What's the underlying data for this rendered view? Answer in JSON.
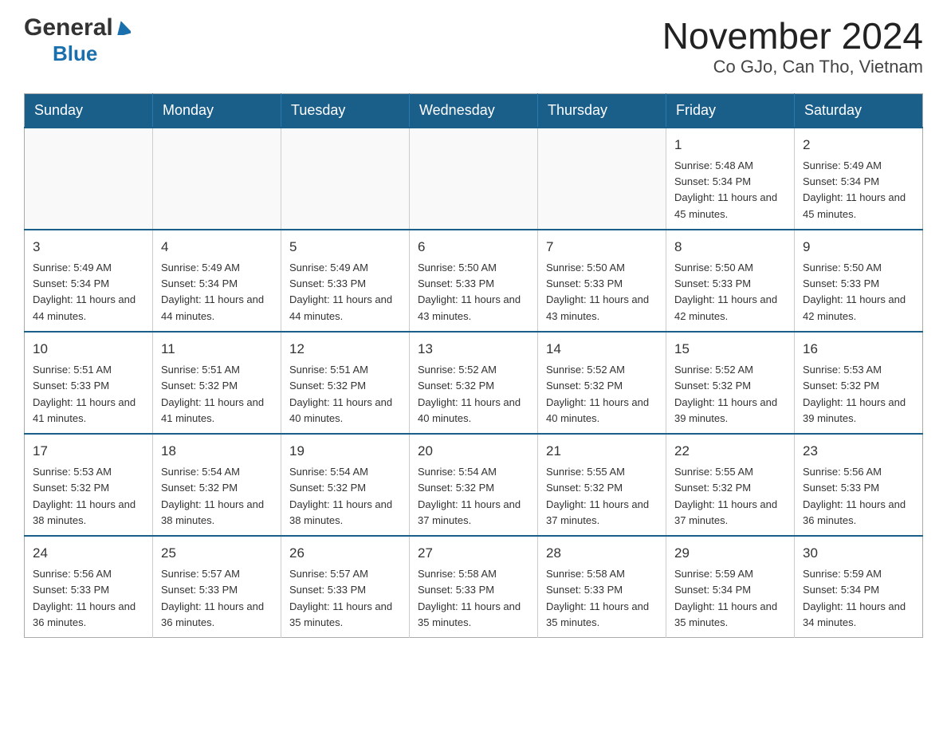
{
  "header": {
    "logo_general": "General",
    "logo_blue": "Blue",
    "title": "November 2024",
    "subtitle": "Co GJo, Can Tho, Vietnam"
  },
  "calendar": {
    "days_of_week": [
      "Sunday",
      "Monday",
      "Tuesday",
      "Wednesday",
      "Thursday",
      "Friday",
      "Saturday"
    ],
    "weeks": [
      [
        {
          "day": "",
          "info": ""
        },
        {
          "day": "",
          "info": ""
        },
        {
          "day": "",
          "info": ""
        },
        {
          "day": "",
          "info": ""
        },
        {
          "day": "",
          "info": ""
        },
        {
          "day": "1",
          "info": "Sunrise: 5:48 AM\nSunset: 5:34 PM\nDaylight: 11 hours and 45 minutes."
        },
        {
          "day": "2",
          "info": "Sunrise: 5:49 AM\nSunset: 5:34 PM\nDaylight: 11 hours and 45 minutes."
        }
      ],
      [
        {
          "day": "3",
          "info": "Sunrise: 5:49 AM\nSunset: 5:34 PM\nDaylight: 11 hours and 44 minutes."
        },
        {
          "day": "4",
          "info": "Sunrise: 5:49 AM\nSunset: 5:34 PM\nDaylight: 11 hours and 44 minutes."
        },
        {
          "day": "5",
          "info": "Sunrise: 5:49 AM\nSunset: 5:33 PM\nDaylight: 11 hours and 44 minutes."
        },
        {
          "day": "6",
          "info": "Sunrise: 5:50 AM\nSunset: 5:33 PM\nDaylight: 11 hours and 43 minutes."
        },
        {
          "day": "7",
          "info": "Sunrise: 5:50 AM\nSunset: 5:33 PM\nDaylight: 11 hours and 43 minutes."
        },
        {
          "day": "8",
          "info": "Sunrise: 5:50 AM\nSunset: 5:33 PM\nDaylight: 11 hours and 42 minutes."
        },
        {
          "day": "9",
          "info": "Sunrise: 5:50 AM\nSunset: 5:33 PM\nDaylight: 11 hours and 42 minutes."
        }
      ],
      [
        {
          "day": "10",
          "info": "Sunrise: 5:51 AM\nSunset: 5:33 PM\nDaylight: 11 hours and 41 minutes."
        },
        {
          "day": "11",
          "info": "Sunrise: 5:51 AM\nSunset: 5:32 PM\nDaylight: 11 hours and 41 minutes."
        },
        {
          "day": "12",
          "info": "Sunrise: 5:51 AM\nSunset: 5:32 PM\nDaylight: 11 hours and 40 minutes."
        },
        {
          "day": "13",
          "info": "Sunrise: 5:52 AM\nSunset: 5:32 PM\nDaylight: 11 hours and 40 minutes."
        },
        {
          "day": "14",
          "info": "Sunrise: 5:52 AM\nSunset: 5:32 PM\nDaylight: 11 hours and 40 minutes."
        },
        {
          "day": "15",
          "info": "Sunrise: 5:52 AM\nSunset: 5:32 PM\nDaylight: 11 hours and 39 minutes."
        },
        {
          "day": "16",
          "info": "Sunrise: 5:53 AM\nSunset: 5:32 PM\nDaylight: 11 hours and 39 minutes."
        }
      ],
      [
        {
          "day": "17",
          "info": "Sunrise: 5:53 AM\nSunset: 5:32 PM\nDaylight: 11 hours and 38 minutes."
        },
        {
          "day": "18",
          "info": "Sunrise: 5:54 AM\nSunset: 5:32 PM\nDaylight: 11 hours and 38 minutes."
        },
        {
          "day": "19",
          "info": "Sunrise: 5:54 AM\nSunset: 5:32 PM\nDaylight: 11 hours and 38 minutes."
        },
        {
          "day": "20",
          "info": "Sunrise: 5:54 AM\nSunset: 5:32 PM\nDaylight: 11 hours and 37 minutes."
        },
        {
          "day": "21",
          "info": "Sunrise: 5:55 AM\nSunset: 5:32 PM\nDaylight: 11 hours and 37 minutes."
        },
        {
          "day": "22",
          "info": "Sunrise: 5:55 AM\nSunset: 5:32 PM\nDaylight: 11 hours and 37 minutes."
        },
        {
          "day": "23",
          "info": "Sunrise: 5:56 AM\nSunset: 5:33 PM\nDaylight: 11 hours and 36 minutes."
        }
      ],
      [
        {
          "day": "24",
          "info": "Sunrise: 5:56 AM\nSunset: 5:33 PM\nDaylight: 11 hours and 36 minutes."
        },
        {
          "day": "25",
          "info": "Sunrise: 5:57 AM\nSunset: 5:33 PM\nDaylight: 11 hours and 36 minutes."
        },
        {
          "day": "26",
          "info": "Sunrise: 5:57 AM\nSunset: 5:33 PM\nDaylight: 11 hours and 35 minutes."
        },
        {
          "day": "27",
          "info": "Sunrise: 5:58 AM\nSunset: 5:33 PM\nDaylight: 11 hours and 35 minutes."
        },
        {
          "day": "28",
          "info": "Sunrise: 5:58 AM\nSunset: 5:33 PM\nDaylight: 11 hours and 35 minutes."
        },
        {
          "day": "29",
          "info": "Sunrise: 5:59 AM\nSunset: 5:34 PM\nDaylight: 11 hours and 35 minutes."
        },
        {
          "day": "30",
          "info": "Sunrise: 5:59 AM\nSunset: 5:34 PM\nDaylight: 11 hours and 34 minutes."
        }
      ]
    ]
  }
}
